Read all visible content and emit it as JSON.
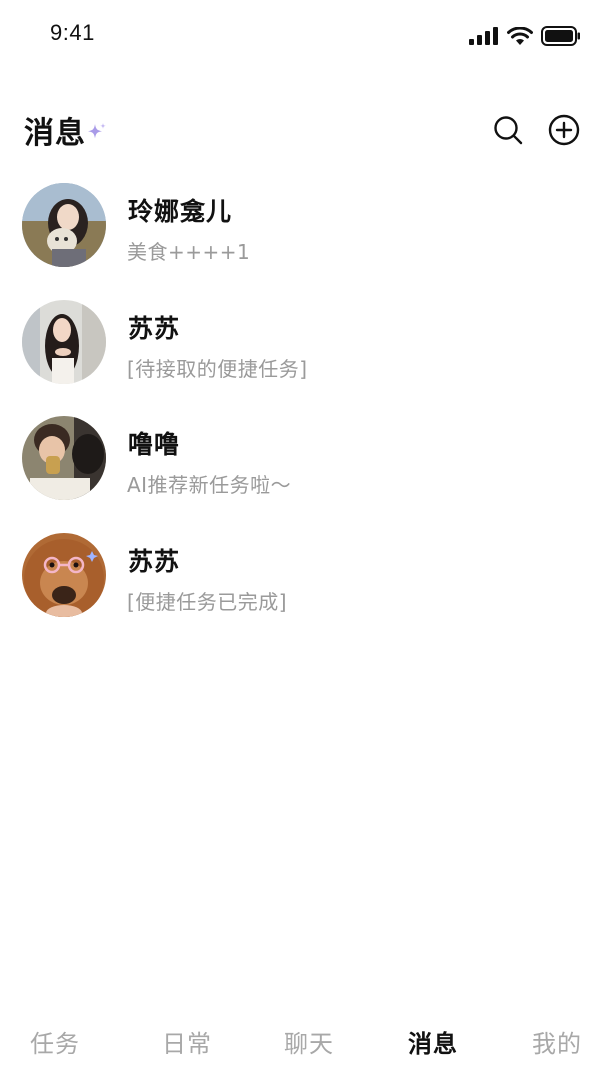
{
  "status_bar": {
    "time": "9:41",
    "icons": [
      "signal-icon",
      "wifi-icon",
      "battery-icon"
    ]
  },
  "header": {
    "title": "消息",
    "icons": [
      "sparkle-icon",
      "search-icon",
      "add-circle-icon"
    ]
  },
  "messages": [
    {
      "name": "玲娜龛儿",
      "preview": "美食++++1"
    },
    {
      "name": "苏苏",
      "preview": "[待接取的便捷任务]"
    },
    {
      "name": "噜噜",
      "preview": "AI推荐新任务啦～"
    },
    {
      "name": "苏苏",
      "preview": "[便捷任务已完成]"
    }
  ],
  "tabs": [
    {
      "label": "任务",
      "active": false
    },
    {
      "label": "日常",
      "active": false
    },
    {
      "label": "聊天",
      "active": false
    },
    {
      "label": "消息",
      "active": true
    },
    {
      "label": "我的",
      "active": false
    }
  ],
  "colors": {
    "text_primary": "#111111",
    "text_secondary": "#9a9a9a",
    "tab_inactive": "#a8a8a8",
    "sparkle": "#a99be8"
  }
}
